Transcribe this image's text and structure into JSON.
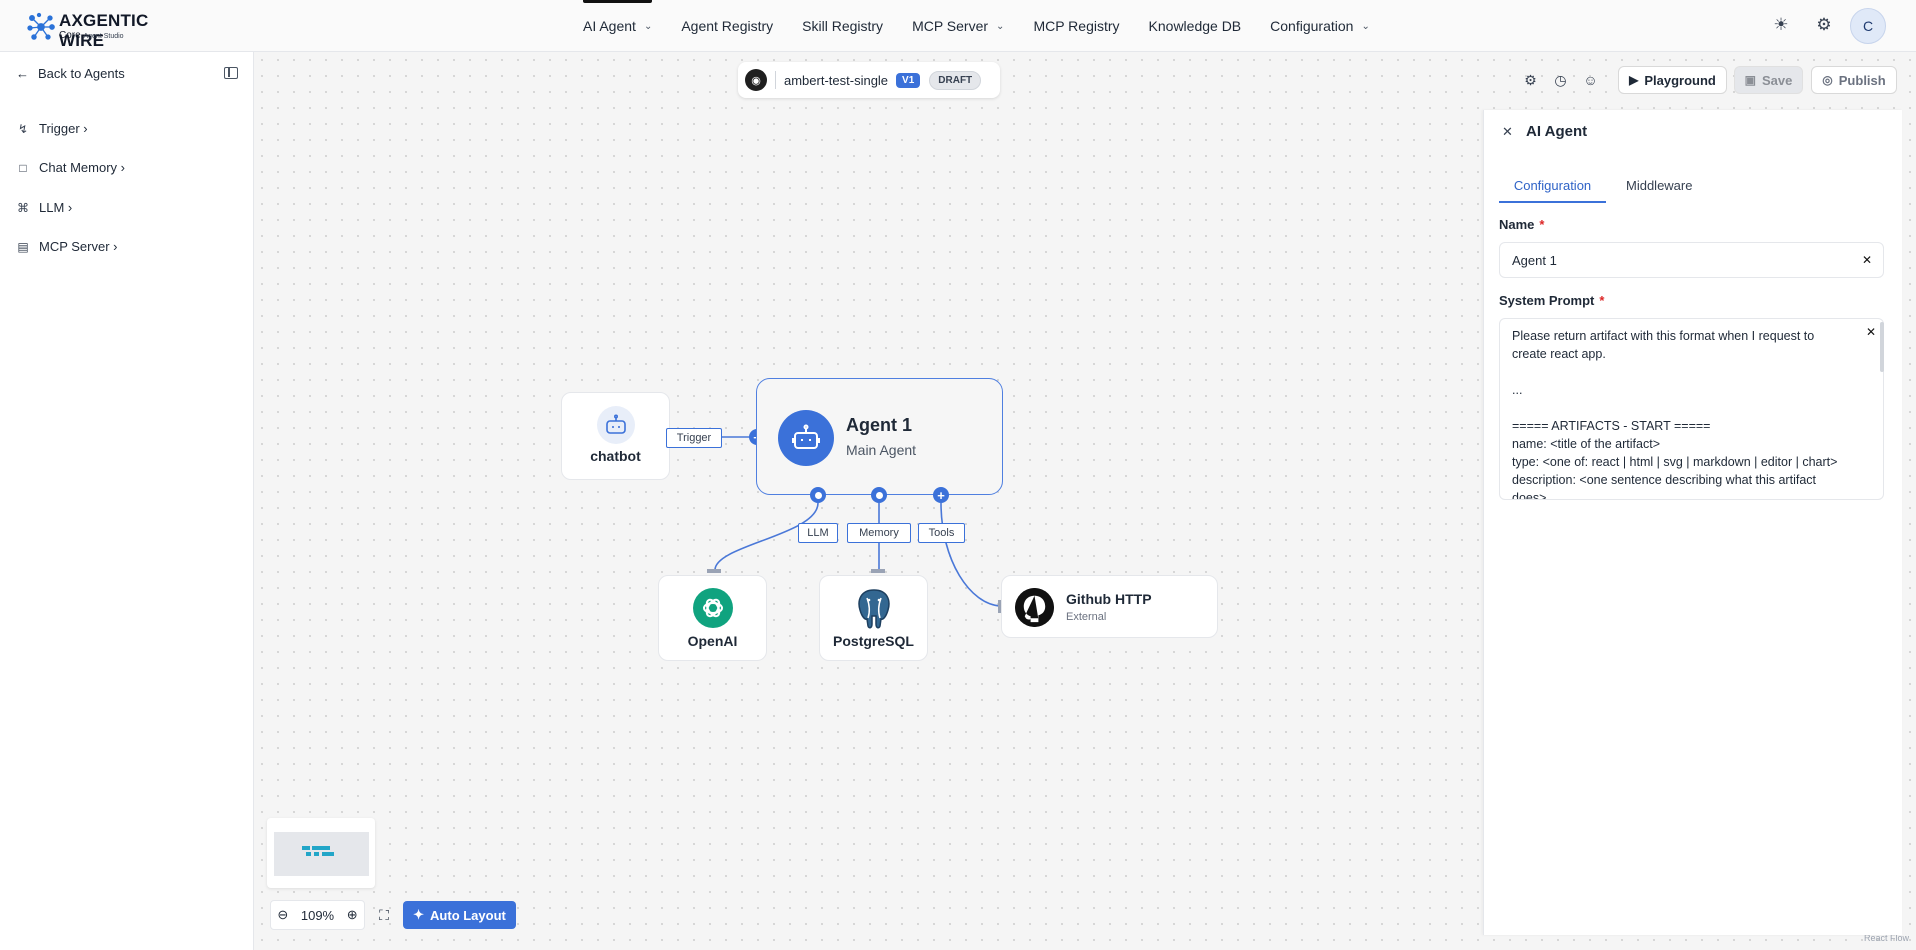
{
  "brand": {
    "name": "AXGENTIC WIRE",
    "sub": "Core",
    "sub_small": "Agent Studio"
  },
  "nav": [
    {
      "label": "AI Agent",
      "dropdown": true,
      "active": true
    },
    {
      "label": "Agent Registry",
      "dropdown": false
    },
    {
      "label": "Skill Registry",
      "dropdown": false
    },
    {
      "label": "MCP Server",
      "dropdown": true
    },
    {
      "label": "MCP Registry",
      "dropdown": false
    },
    {
      "label": "Knowledge DB",
      "dropdown": false
    },
    {
      "label": "Configuration",
      "dropdown": true
    }
  ],
  "header_icons": [
    "sun-icon",
    "gear-icon"
  ],
  "user": {
    "initial": "C"
  },
  "sidebar": {
    "back_label": "Back to Agents",
    "items": [
      {
        "label": "Trigger ›",
        "icon": "bolt-icon"
      },
      {
        "label": "Chat Memory ›",
        "icon": "message-icon"
      },
      {
        "label": "LLM ›",
        "icon": "cpu-icon"
      },
      {
        "label": "MCP Server ›",
        "icon": "server-icon"
      }
    ]
  },
  "agent_bar": {
    "name": "ambert-test-single",
    "version": "V1",
    "status": "DRAFT"
  },
  "toolbar": {
    "playground": "Playground",
    "save": "Save",
    "publish": "Publish",
    "icons": [
      "settings-icon",
      "history-icon",
      "users-icon"
    ]
  },
  "nodes": {
    "chatbot": {
      "label": "chatbot"
    },
    "agent": {
      "title": "Agent 1",
      "subtitle": "Main Agent"
    },
    "openai": {
      "label": "OpenAI"
    },
    "postgres": {
      "label": "PostgreSQL"
    },
    "github": {
      "title": "Github HTTP",
      "subtitle": "External"
    }
  },
  "edge_labels": {
    "trigger": "Trigger",
    "llm": "LLM",
    "memory": "Memory",
    "tools": "Tools"
  },
  "controls": {
    "zoom": "109%",
    "auto_layout": "Auto Layout",
    "attribution": "React Flow"
  },
  "panel": {
    "title": "AI Agent",
    "tabs": [
      "Configuration",
      "Middleware"
    ],
    "name_label": "Name",
    "name_value": "Agent 1",
    "prompt_label": "System Prompt",
    "prompt_value": "Please return artifact with this format when I request to create react app.\n\n...\n\n===== ARTIFACTS - START =====\nname: <title of the artifact>\ntype: <one of: react | html | svg | markdown | editor | chart>\ndescription: <one sentence describing what this artifact does>"
  },
  "colors": {
    "accent": "#3b71d9",
    "required": "#dc2626",
    "minimap": "#22a6c8"
  }
}
